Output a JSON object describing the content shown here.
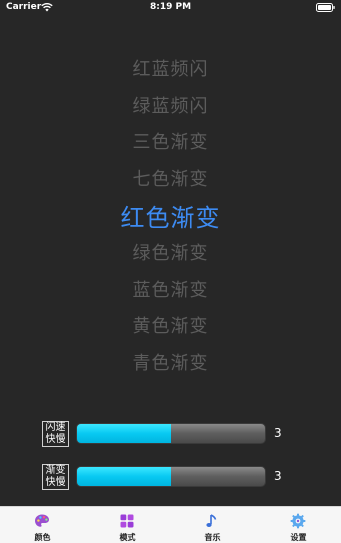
{
  "status_bar": {
    "carrier": "Carrier",
    "time": "8:19 PM"
  },
  "picker": {
    "items": [
      "红蓝频闪",
      "绿蓝频闪",
      "三色渐变",
      "七色渐变",
      "红色渐变",
      "绿色渐变",
      "蓝色渐变",
      "黄色渐变",
      "青色渐变"
    ],
    "selected_index": 4
  },
  "controls": {
    "flash_speed": {
      "label_line1": "闪速",
      "label_line2": "快慢",
      "value": "3",
      "fill_fraction": 0.5
    },
    "fade_speed": {
      "label_line1": "渐变",
      "label_line2": "快慢",
      "value": "3",
      "fill_fraction": 0.5
    }
  },
  "tab_bar": {
    "tabs": [
      {
        "label": "颜色",
        "icon": "palette-icon"
      },
      {
        "label": "模式",
        "icon": "grid-icon"
      },
      {
        "label": "音乐",
        "icon": "music-note-icon"
      },
      {
        "label": "设置",
        "icon": "gear-icon"
      }
    ]
  },
  "colors": {
    "background": "#272727",
    "selected_text": "#3d8bf2",
    "unselected_text": "#5c5c5c",
    "slider_fill": "#08c9f2"
  }
}
